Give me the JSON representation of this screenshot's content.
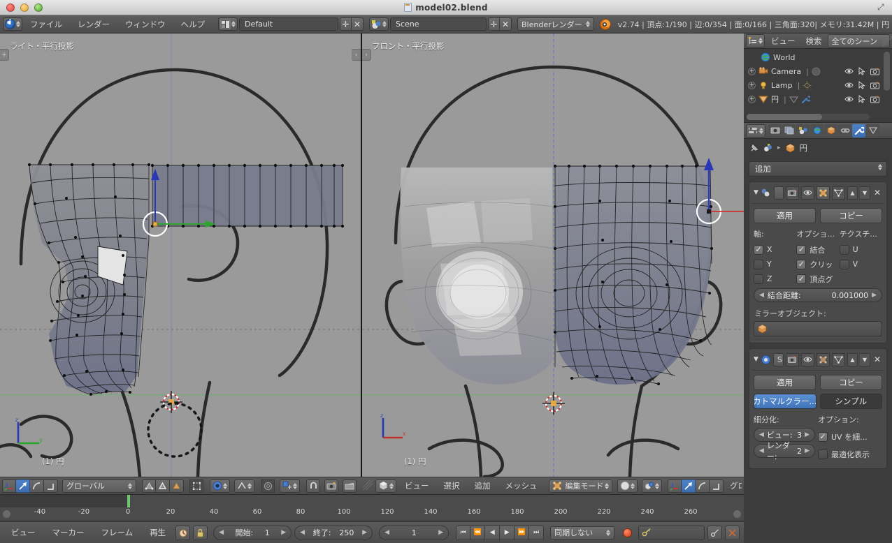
{
  "window": {
    "mac_title": "model02.blend",
    "traffic_lights": [
      "close",
      "minimize",
      "zoom"
    ]
  },
  "topbar": {
    "menus": [
      "ファイル",
      "レンダー",
      "ウィンドウ",
      "ヘルプ"
    ],
    "screen_layout": "Default",
    "scene_name": "Scene",
    "render_engine": "Blenderレンダー",
    "status": "v2.74 | 頂点:1/190 | 辺:0/354 | 面:0/166 | 三角面:320| メモリ:31.42M | 円"
  },
  "viewports": {
    "left": {
      "label": "ライト・平行投影",
      "object_name": "(1) 円",
      "gizmo_axes": [
        "z",
        "y"
      ]
    },
    "right": {
      "label": "フロント・平行投影",
      "object_name": "(1) 円",
      "gizmo_axes": [
        "z",
        "x"
      ]
    }
  },
  "viewport_header_left": {
    "transform_orientation": "グローバル"
  },
  "viewport_header_right": {
    "menus": [
      "ビュー",
      "選択",
      "追加",
      "メッシュ"
    ],
    "mode": "編集モード",
    "transform_orientation": "グロ"
  },
  "outliner": {
    "view_menu": "ビュー",
    "search_menu": "検索",
    "filter": "全てのシーン",
    "items": [
      {
        "name": "World",
        "icon": "world-icon",
        "indent": 1,
        "expandable": false
      },
      {
        "name": "Camera",
        "icon": "camera-icon",
        "indent": 0,
        "expandable": true
      },
      {
        "name": "Lamp",
        "icon": "lamp-icon",
        "indent": 0,
        "expandable": true
      },
      {
        "name": "円",
        "icon": "mesh-icon",
        "indent": 0,
        "expandable": true
      }
    ]
  },
  "properties": {
    "tabs": [
      "render-tab",
      "render-layers-tab",
      "scene-tab",
      "world-tab",
      "object-tab",
      "constraints-tab",
      "modifier-tab",
      "data-tab"
    ],
    "active_tab": "modifier-tab",
    "breadcrumb_object": "円",
    "add_modifier_label": "追加",
    "modifiers": [
      {
        "type": "mirror",
        "apply_label": "適用",
        "copy_label": "コピー",
        "column_headers": [
          "軸:",
          "オプショ...",
          "テクスチ..."
        ],
        "axis": [
          {
            "label": "X",
            "checked": true
          },
          {
            "label": "Y",
            "checked": false
          },
          {
            "label": "Z",
            "checked": false
          }
        ],
        "options": [
          {
            "label": "結合",
            "checked": true
          },
          {
            "label": "クリッ",
            "checked": true
          },
          {
            "label": "頂点グ",
            "checked": true
          }
        ],
        "texture": [
          {
            "label": "U",
            "checked": false
          },
          {
            "label": "V",
            "checked": false
          }
        ],
        "merge_limit_label": "結合距離:",
        "merge_limit_value": "0.001000",
        "mirror_object_label": "ミラーオブジェクト:",
        "mirror_object_value": ""
      },
      {
        "type": "subsurf",
        "badge": "S",
        "apply_label": "適用",
        "copy_label": "コピー",
        "algorithms": [
          {
            "label": "カトマルクラー...",
            "selected": true
          },
          {
            "label": "シンプル",
            "selected": false
          }
        ],
        "subdivisions_label": "細分化:",
        "options_label": "オプション:",
        "view_label": "ビュー:",
        "view_value": "3",
        "render_label": "レンダー:",
        "render_value": "2",
        "option_items": [
          {
            "label": "UV を細...",
            "checked": true
          },
          {
            "label": "最適化表示",
            "checked": false
          }
        ]
      }
    ]
  },
  "timeline": {
    "menus": [
      "ビュー",
      "マーカー",
      "フレーム",
      "再生"
    ],
    "start_label": "開始:",
    "start_value": "1",
    "end_label": "終了:",
    "end_value": "250",
    "current_frame": "1",
    "sync_mode": "同期しない",
    "ruler_ticks": [
      "-40",
      "-20",
      "0",
      "20",
      "40",
      "60",
      "80",
      "100",
      "120",
      "140",
      "160",
      "180",
      "200",
      "220",
      "240",
      "260"
    ],
    "playhead_frame": 1
  },
  "colors": {
    "accent_blue": "#4d82c8",
    "panel_bg": "#3c3c3c",
    "header_bg": "#545454",
    "viewport_bg": "#9a9a9a",
    "axis_x": "#c03030",
    "axis_y": "#35a035",
    "axis_z": "#3040c0"
  }
}
